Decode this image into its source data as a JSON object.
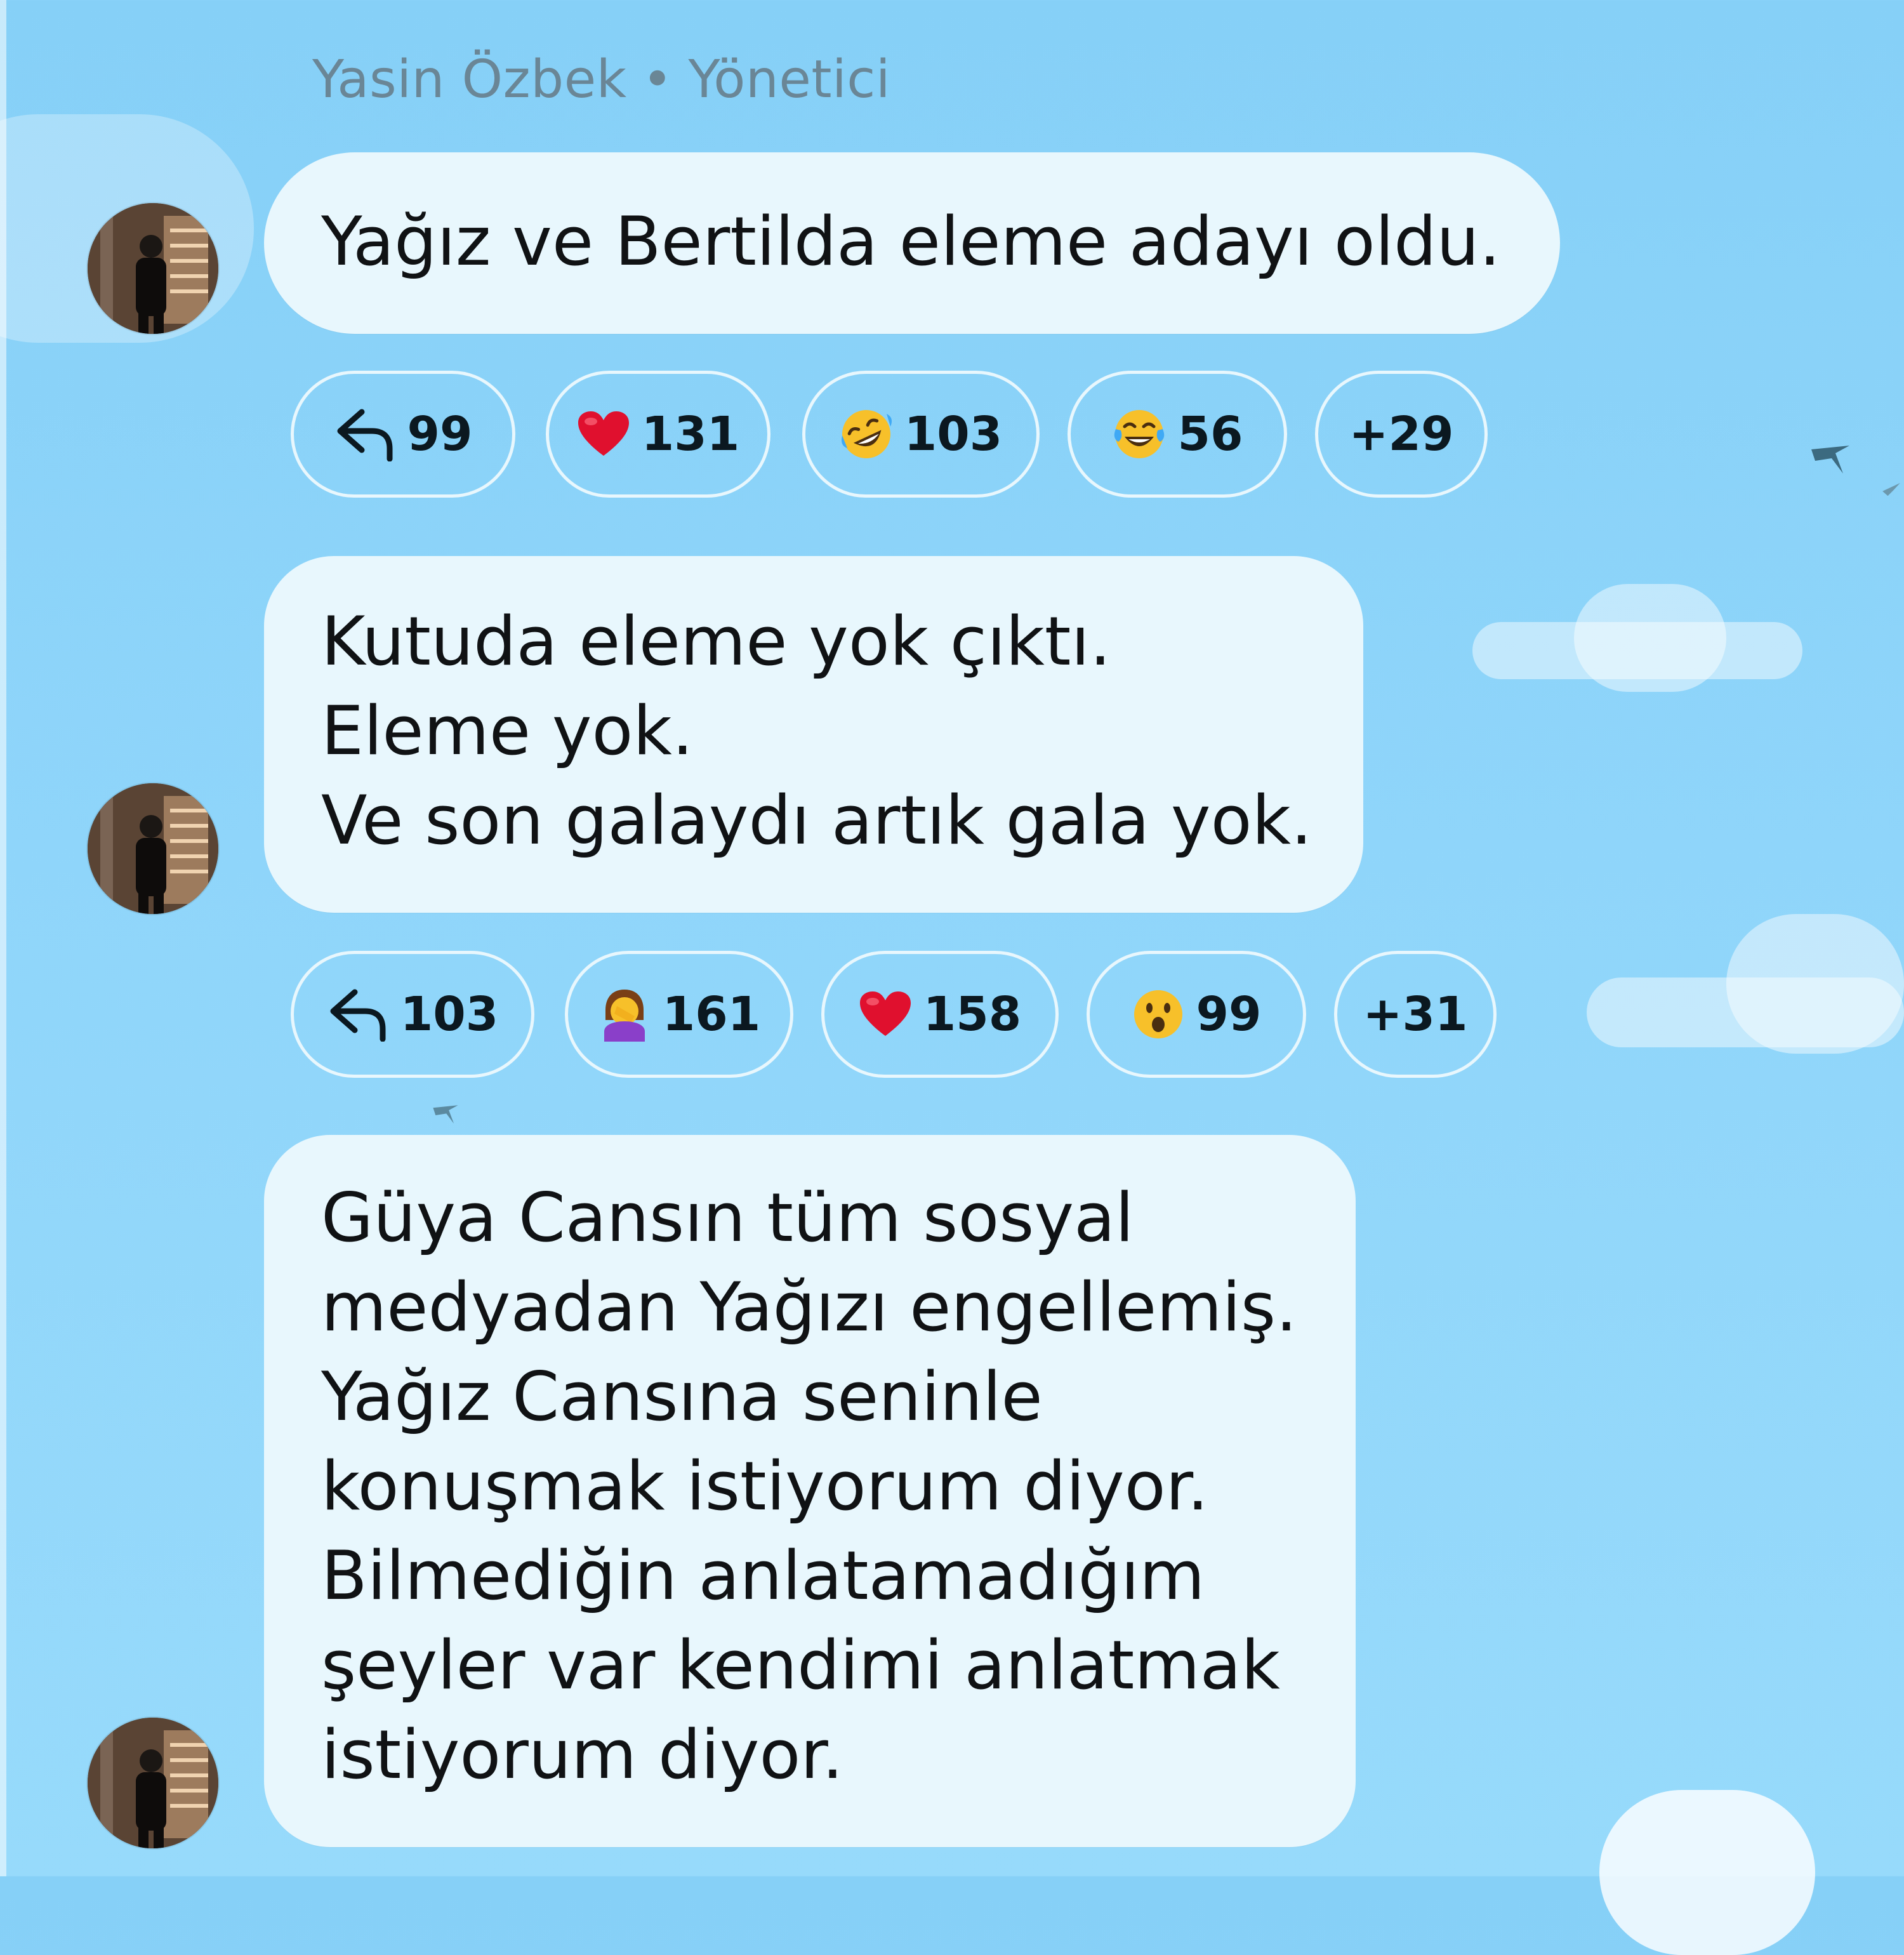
{
  "sender": {
    "name": "Yasin Özbek",
    "separator": "•",
    "role": "Yönetici"
  },
  "messages": [
    {
      "text": "Yağız ve Bertilda eleme adayı oldu.",
      "reactions": [
        {
          "icon": "reply-icon",
          "count": "99"
        },
        {
          "icon": "red-heart-emoji",
          "count": "131"
        },
        {
          "icon": "rolling-laughing-emoji",
          "count": "103"
        },
        {
          "icon": "tears-of-joy-emoji",
          "count": "56"
        },
        {
          "icon": "",
          "count": "+29"
        }
      ]
    },
    {
      "text": "Kutuda eleme yok çıktı.\nEleme yok.\nVe son galaydı artık gala yok.",
      "reactions": [
        {
          "icon": "reply-icon",
          "count": "103"
        },
        {
          "icon": "facepalm-woman-emoji",
          "count": "161"
        },
        {
          "icon": "red-heart-emoji",
          "count": "158"
        },
        {
          "icon": "surprised-face-emoji",
          "count": "99"
        },
        {
          "icon": "",
          "count": "+31"
        }
      ]
    },
    {
      "text": "Güya Cansın tüm sosyal\nmedyadan Yağızı engellemiş.\nYağız Cansına seninle\nkonuşmak istiyorum diyor.\nBilmediğin anlatamadığım\nşeyler var kendimi anlatmak\nistiyorum diyor.",
      "reactions": []
    }
  ],
  "colors": {
    "background": "#8ed4f8",
    "bubble": "#e8f7fd",
    "text": "#101214",
    "sender": "#6a8696",
    "heart": "#e0102e"
  }
}
